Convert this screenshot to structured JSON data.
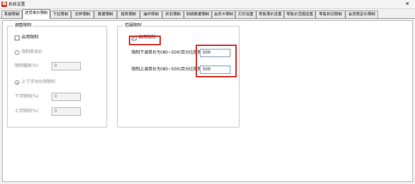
{
  "window": {
    "title": "系统设置",
    "app_icon_glyph": "福",
    "close_glyph": "✕"
  },
  "tabs": [
    {
      "label": "系统限制"
    },
    {
      "label": "进货单价限制"
    },
    {
      "label": "下拉限制"
    },
    {
      "label": "式样限制"
    },
    {
      "label": "数据限制"
    },
    {
      "label": "报表限制"
    },
    {
      "label": "操作限制"
    },
    {
      "label": "折扣限制"
    },
    {
      "label": "网络数据限制"
    },
    {
      "label": "会员卡限制"
    },
    {
      "label": "打印设置"
    },
    {
      "label": "零售限价设置"
    },
    {
      "label": "零售价范围设置"
    },
    {
      "label": "零售折扣限制"
    },
    {
      "label": "会员限定价限制"
    }
  ],
  "left_group": {
    "title": "调整限制",
    "enable_label": "启用限制",
    "radio_option_1": "限制单品价",
    "field_1_label": "限制幅度(%)",
    "field_1_value": "0",
    "radio_option_2": "上下浮动比例限制",
    "field_2_label": "下浮限制(%)",
    "field_2_value": "0",
    "field_3_label": "上浮限制(%)",
    "field_3_value": "0"
  },
  "right_group": {
    "title": "范围限制",
    "enable_label": "启用限制",
    "enable_checked_glyph": "✓",
    "field_1_label": "限制下调单价为(80~500)百分比限制",
    "field_1_value": "500",
    "field_2_label": "限制上调单价为(80~500)百分比限制",
    "field_2_value": "500"
  },
  "colors": {
    "highlight": "#d4322a",
    "app_icon": "#cc2a1a"
  }
}
